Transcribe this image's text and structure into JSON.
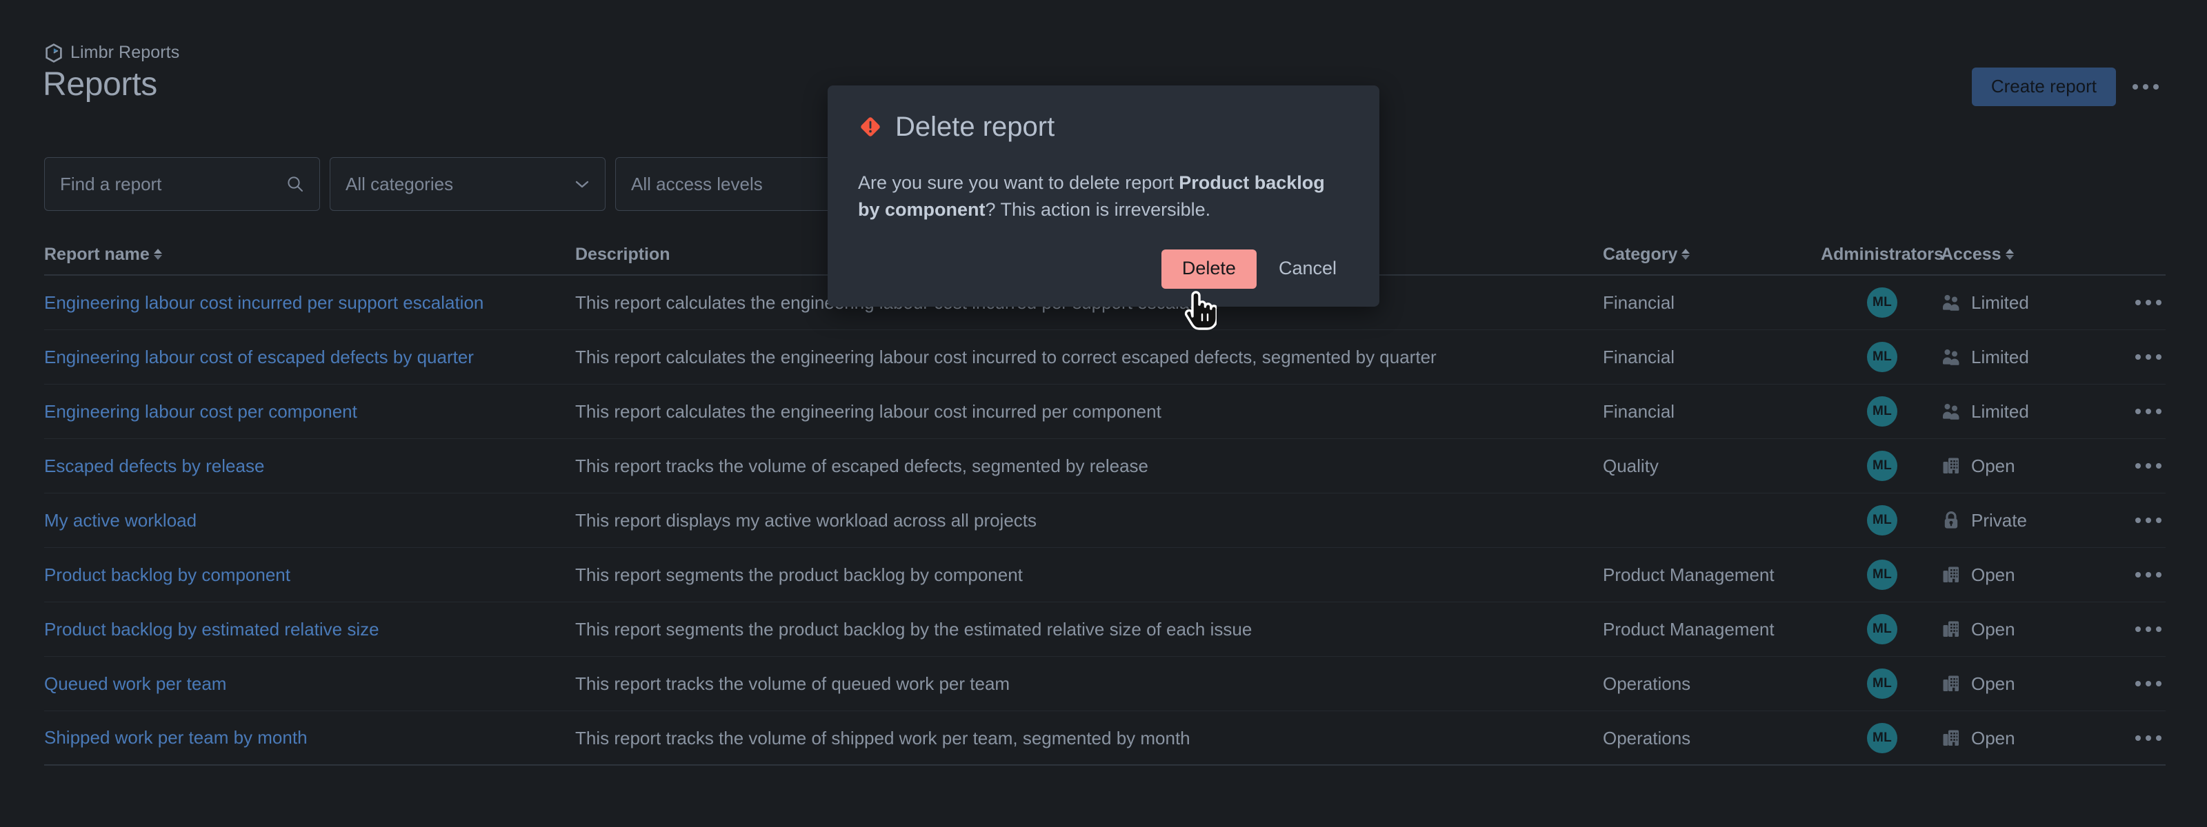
{
  "app": {
    "breadcrumb": "Limbr Reports",
    "logo_icon": "limbr-hexagon-play-icon",
    "page_title": "Reports"
  },
  "header": {
    "create_label": "Create report",
    "more_icon": "ellipsis-icon"
  },
  "filters": {
    "search_placeholder": "Find a report",
    "search_icon": "search-icon",
    "category_value": "All categories",
    "category_chevron_icon": "chevron-down-icon",
    "access_value": "All access levels"
  },
  "table": {
    "columns": {
      "name": "Report name",
      "description": "Description",
      "category": "Category",
      "administrators": "Administrators",
      "access": "Access"
    },
    "sortable": [
      "name",
      "category",
      "access"
    ],
    "rows": [
      {
        "name": "Engineering labour cost incurred per support escalation",
        "description": "This report calculates the engineering labour cost incurred per support escalation",
        "category": "Financial",
        "admin_initials": "ML",
        "access": "Limited",
        "access_icon": "people-group-icon"
      },
      {
        "name": "Engineering labour cost of escaped defects by quarter",
        "description": "This report calculates the engineering labour cost incurred to correct escaped defects, segmented by quarter",
        "category": "Financial",
        "admin_initials": "ML",
        "access": "Limited",
        "access_icon": "people-group-icon"
      },
      {
        "name": "Engineering labour cost per component",
        "description": "This report calculates the engineering labour cost incurred per component",
        "category": "Financial",
        "admin_initials": "ML",
        "access": "Limited",
        "access_icon": "people-group-icon"
      },
      {
        "name": "Escaped defects by release",
        "description": "This report tracks the volume of escaped defects, segmented by release",
        "category": "Quality",
        "admin_initials": "ML",
        "access": "Open",
        "access_icon": "building-icon"
      },
      {
        "name": "My active workload",
        "description": "This report displays my active workload across all projects",
        "category": "",
        "admin_initials": "ML",
        "access": "Private",
        "access_icon": "lock-icon"
      },
      {
        "name": "Product backlog by component",
        "description": "This report segments the product backlog by component",
        "category": "Product Management",
        "admin_initials": "ML",
        "access": "Open",
        "access_icon": "building-icon"
      },
      {
        "name": "Product backlog by estimated relative size",
        "description": "This report segments the product backlog by the estimated relative size of each issue",
        "category": "Product Management",
        "admin_initials": "ML",
        "access": "Open",
        "access_icon": "building-icon"
      },
      {
        "name": "Queued work per team",
        "description": "This report tracks the volume of queued work per team",
        "category": "Operations",
        "admin_initials": "ML",
        "access": "Open",
        "access_icon": "building-icon"
      },
      {
        "name": "Shipped work per team by month",
        "description": "This report tracks the volume of shipped work per team, segmented by month",
        "category": "Operations",
        "admin_initials": "ML",
        "access": "Open",
        "access_icon": "building-icon"
      }
    ],
    "row_more_icon": "ellipsis-icon"
  },
  "modal": {
    "warn_icon": "warning-diamond-icon",
    "title": "Delete report",
    "body_prefix": "Are you sure you want to delete report ",
    "body_report_name": "Product backlog by component",
    "body_suffix": "? This action is irreversible.",
    "confirm_label": "Delete",
    "cancel_label": "Cancel"
  },
  "colors": {
    "page_bg": "#1a1d21",
    "modal_bg": "#292f38",
    "primary_button": "#2f4c74",
    "danger_button": "#f79a96",
    "link": "#4a7ab8",
    "avatar": "#1f6b78",
    "warning": "#f4573f"
  },
  "cursor": {
    "icon": "pointer-hand-cursor"
  }
}
